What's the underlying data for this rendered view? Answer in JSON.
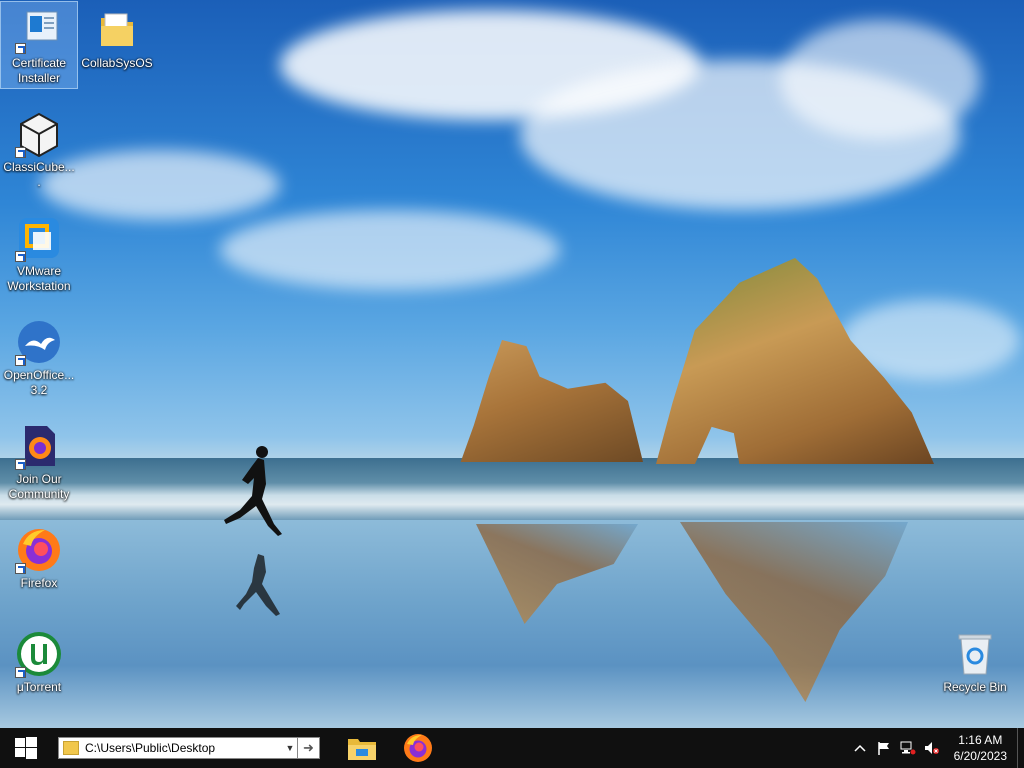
{
  "desktop": {
    "icons": [
      {
        "label": "Certificate Installer",
        "icon": "certificate-installer-icon",
        "selected": true
      },
      {
        "label": "CollabSysOS",
        "icon": "folder-icon"
      },
      {
        "label": "ClassiCube....",
        "icon": "classicube-icon"
      },
      {
        "label": "VMware Workstation",
        "icon": "vmware-icon"
      },
      {
        "label": "OpenOffice... 3.2",
        "icon": "openoffice-icon"
      },
      {
        "label": "Join Our Community",
        "icon": "firefox-file-icon"
      },
      {
        "label": "Firefox",
        "icon": "firefox-icon"
      },
      {
        "label": "μTorrent",
        "icon": "utorrent-icon"
      },
      {
        "label": "Recycle Bin",
        "icon": "recycle-bin-icon"
      }
    ]
  },
  "taskbar": {
    "start_icon": "windows-start-icon",
    "address_value": "C:\\Users\\Public\\Desktop",
    "pinned": [
      {
        "name": "File Explorer",
        "icon": "file-explorer-icon"
      },
      {
        "name": "Firefox",
        "icon": "firefox-icon"
      }
    ],
    "tray": {
      "icons": [
        "chevron-up-icon",
        "flag-icon",
        "network-icon",
        "volume-muted-icon"
      ],
      "time": "1:16 AM",
      "date": "6/20/2023"
    }
  },
  "colors": {
    "taskbar_bg": "#101010",
    "accent_blue": "#0078d7"
  }
}
